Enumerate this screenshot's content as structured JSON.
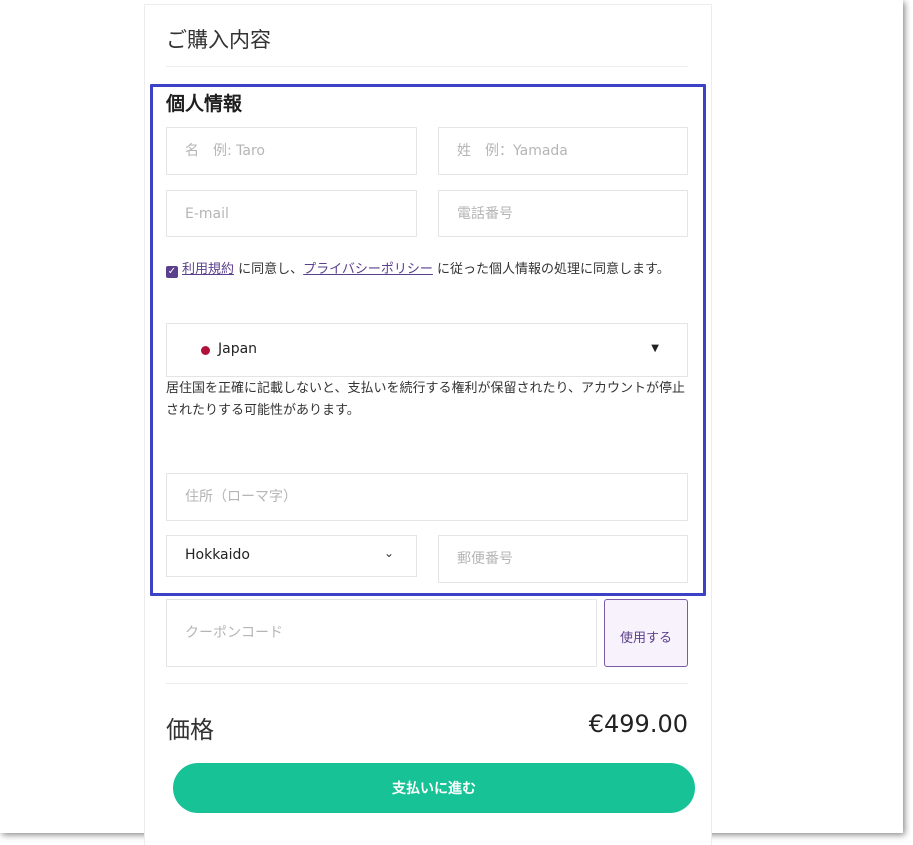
{
  "summary": {
    "title": "ご購入内容"
  },
  "personal": {
    "title": "個人情報",
    "first_name_placeholder": "名　例: Taro",
    "last_name_placeholder": "姓　例：Yamada",
    "email_placeholder": "E-mail",
    "phone_placeholder": "電話番号",
    "consent": {
      "checked": true,
      "terms_link": "利用規約",
      "text_part1": " に同意し、",
      "privacy_link": "プライバシーポリシー",
      "text_part2": " に従った個人情報の処理に同意します。"
    },
    "country": {
      "selected": "Japan",
      "flag_color": "#b0123a"
    },
    "notice": "居住国を正確に記載しないと、支払いを続行する権利が保留されたり、アカウントが停止されたりする可能性があります。",
    "address_placeholder": "住所（ローマ字）",
    "prefecture": {
      "selected": "Hokkaido"
    },
    "postal_placeholder": "郵便番号"
  },
  "coupon": {
    "placeholder": "クーポンコード",
    "apply_label": "使用する"
  },
  "price": {
    "label": "価格",
    "value": "€499.00"
  },
  "pay_button": "支払いに進む",
  "colors": {
    "accent": "#5a3f8c",
    "pay_button": "#17c396",
    "highlight_border": "#3d41c4"
  }
}
